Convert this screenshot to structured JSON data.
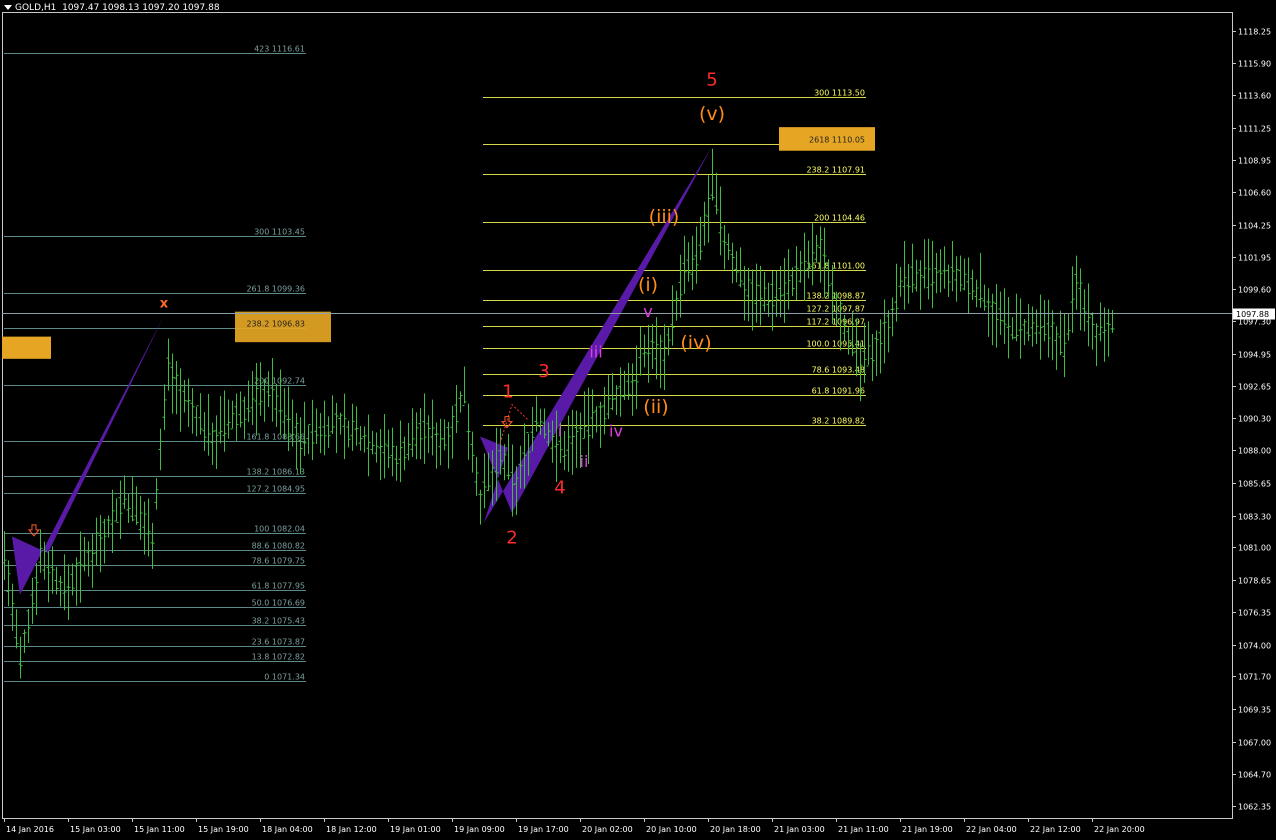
{
  "header": {
    "symbol": "GOLD,H1",
    "ohlc": "1097.47 1098.13 1097.20 1097.88"
  },
  "colors": {
    "background": "#000000",
    "candles": "#3fbf3f",
    "fib_old": "#5c8a8a",
    "fib_new": "#d8d84a",
    "fib_new_text": "#ffff66",
    "fib_old_text": "#7e9e9e",
    "pattern": "#5a1aa8",
    "highlight": "#e6a623",
    "wave_major": "#ff2a2a",
    "wave_minor": "#ff8c1a",
    "wave_sub": "#e040e0",
    "axis_text": "#ffffff",
    "current_line": "#8aa0aa"
  },
  "chart_data": {
    "type": "candlestick",
    "title": "GOLD,H1",
    "current_price": "1097.88",
    "y_range": [
      1061.5,
      1119.6
    ],
    "y_ticks": [
      "1118.25",
      "1115.90",
      "1113.60",
      "1111.25",
      "1108.95",
      "1106.60",
      "1104.25",
      "1101.95",
      "1099.60",
      "1097.30",
      "1094.95",
      "1092.65",
      "1090.30",
      "1088.00",
      "1085.65",
      "1083.30",
      "1081.00",
      "1078.65",
      "1076.35",
      "1074.00",
      "1071.70",
      "1069.35",
      "1067.00",
      "1064.70",
      "1062.35"
    ],
    "x_ticks": [
      "14 Jan 2016",
      "15 Jan 03:00",
      "15 Jan 11:00",
      "15 Jan 19:00",
      "18 Jan 04:00",
      "18 Jan 12:00",
      "19 Jan 01:00",
      "19 Jan 09:00",
      "19 Jan 17:00",
      "20 Jan 02:00",
      "20 Jan 10:00",
      "20 Jan 18:00",
      "21 Jan 03:00",
      "21 Jan 11:00",
      "21 Jan 19:00",
      "22 Jan 04:00",
      "22 Jan 12:00",
      "22 Jan 20:00"
    ],
    "fib_old": [
      {
        "label": "423 1116.61",
        "price": 1116.61
      },
      {
        "label": "300 1103.45",
        "price": 1103.45
      },
      {
        "label": "261.8 1099.36",
        "price": 1099.36
      },
      {
        "label": "238.2 1096.83",
        "price": 1096.83
      },
      {
        "label": "200 1092.74",
        "price": 1092.74
      },
      {
        "label": "161.8 1088.66",
        "price": 1088.66
      },
      {
        "label": "138.2 1086.13",
        "price": 1086.13
      },
      {
        "label": "127.2 1084.95",
        "price": 1084.95
      },
      {
        "label": "100 1082.04",
        "price": 1082.04
      },
      {
        "label": "88.6 1080.82",
        "price": 1080.82
      },
      {
        "label": "78.6 1079.75",
        "price": 1079.75
      },
      {
        "label": "61.8 1077.95",
        "price": 1077.95
      },
      {
        "label": "50.0 1076.69",
        "price": 1076.69
      },
      {
        "label": "38.2 1075.43",
        "price": 1075.43
      },
      {
        "label": "23.6 1073.87",
        "price": 1073.87
      },
      {
        "label": "13.8 1072.82",
        "price": 1072.82
      },
      {
        "label": "0 1071.34",
        "price": 1071.34
      }
    ],
    "fib_new": [
      {
        "label": "300 1113.50",
        "price": 1113.5
      },
      {
        "label": "2618 1110.05",
        "price": 1110.05
      },
      {
        "label": "238.2 1107.91",
        "price": 1107.91
      },
      {
        "label": "200 1104.46",
        "price": 1104.46
      },
      {
        "label": "161.8 1101.00",
        "price": 1101.0
      },
      {
        "label": "138.2 1098.87",
        "price": 1098.87
      },
      {
        "label": "127.2 1097.87",
        "price": 1097.87
      },
      {
        "label": "117.2 1096.97",
        "price": 1096.97
      },
      {
        "label": "100.0 1095.41",
        "price": 1095.41
      },
      {
        "label": "78.6 1093.48",
        "price": 1093.48
      },
      {
        "label": "61.8 1091.96",
        "price": 1091.96
      },
      {
        "label": "38.2 1089.82",
        "price": 1089.82
      }
    ],
    "wave_labels": [
      {
        "text": "5",
        "kind": "major",
        "price": 1114.3,
        "bar": 177
      },
      {
        "text": "(v)",
        "kind": "minor",
        "price": 1111.8,
        "bar": 177
      },
      {
        "text": "(iii)",
        "kind": "minor",
        "price": 1104.4,
        "bar": 165
      },
      {
        "text": "(i)",
        "kind": "minor",
        "price": 1099.5,
        "bar": 161
      },
      {
        "text": "v",
        "kind": "sub",
        "price": 1097.6,
        "bar": 161
      },
      {
        "text": "(iv)",
        "kind": "minor",
        "price": 1095.3,
        "bar": 173
      },
      {
        "text": "iii",
        "kind": "sub",
        "price": 1094.7,
        "bar": 148
      },
      {
        "text": "3",
        "kind": "major",
        "price": 1093.3,
        "bar": 135
      },
      {
        "text": "1",
        "kind": "major",
        "price": 1091.8,
        "bar": 126
      },
      {
        "text": "(ii)",
        "kind": "minor",
        "price": 1090.7,
        "bar": 163
      },
      {
        "text": "i",
        "kind": "sub",
        "price": 1089.0,
        "bar": 139
      },
      {
        "text": "iv",
        "kind": "sub",
        "price": 1089.0,
        "bar": 153
      },
      {
        "text": "ii",
        "kind": "sub",
        "price": 1086.8,
        "bar": 145
      },
      {
        "text": "4",
        "kind": "major",
        "price": 1084.9,
        "bar": 139
      },
      {
        "text": "2",
        "kind": "major",
        "price": 1081.3,
        "bar": 127
      },
      {
        "text": "x",
        "kind": "major",
        "price": 1098.3,
        "bar": 40
      }
    ]
  }
}
